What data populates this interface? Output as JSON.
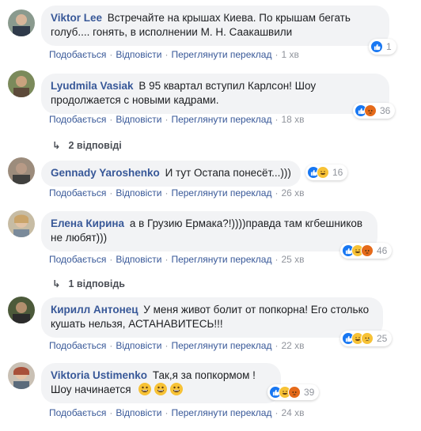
{
  "comments": [
    {
      "author": "Viktor Lee",
      "text": "Встречайте на крышах Киева. По крышам бегать голуб.... гонять, в исполнении М. Н. Саакашвили",
      "actions": {
        "like": "Подобається",
        "reply": "Відповісти",
        "translate": "Переглянути переклад"
      },
      "time": "1 хв",
      "reaction_count": "1",
      "reactions": [
        "like"
      ]
    },
    {
      "author": "Lyudmila Vasiak",
      "text": "В 95 квартал вступил Карлсон! Шоу продолжается с новыми кадрами.",
      "actions": {
        "like": "Подобається",
        "reply": "Відповісти",
        "translate": "Переглянути переклад"
      },
      "time": "18 хв",
      "reaction_count": "36",
      "reactions": [
        "like",
        "angry"
      ],
      "replies": "2 відповіді"
    },
    {
      "author": "Gennady Yaroshenko",
      "text": "И тут Остапа понесёт...)))",
      "actions": {
        "like": "Подобається",
        "reply": "Відповісти",
        "translate": "Переглянути переклад"
      },
      "time": "26 хв",
      "reaction_count": "16",
      "reactions": [
        "like",
        "haha"
      ]
    },
    {
      "author": "Елена Кирина",
      "text": "а в Грузию Ермака?!))))правда там кгбешников не любят)))",
      "actions": {
        "like": "Подобається",
        "reply": "Відповісти",
        "translate": "Переглянути переклад"
      },
      "time": "25 хв",
      "reaction_count": "46",
      "reactions": [
        "like",
        "haha",
        "angry"
      ],
      "replies": "1 відповідь"
    },
    {
      "author": "Кирилл Антонец",
      "text": "У меня живот болит от попкорна! Его столько кушать нельзя, АСТАНАВИТЕСЬ!!!",
      "actions": {
        "like": "Подобається",
        "reply": "Відповісти",
        "translate": "Переглянути переклад"
      },
      "time": "22 хв",
      "reaction_count": "25",
      "reactions": [
        "like",
        "haha",
        "sad"
      ]
    },
    {
      "author": "Viktoria Ustimenko",
      "text_line1": "Так,я за попкормом !",
      "text_line2": "Шоу начинается",
      "actions": {
        "like": "Подобається",
        "reply": "Відповісти",
        "translate": "Переглянути переклад"
      },
      "time": "24 хв",
      "reaction_count": "39",
      "reactions": [
        "like",
        "haha",
        "angry"
      ]
    }
  ],
  "colors": {
    "author": "#385898",
    "bubble": "#f2f3f5",
    "like": "#1877f2",
    "haha": "#f7c236",
    "angry": "#e56a1a"
  }
}
